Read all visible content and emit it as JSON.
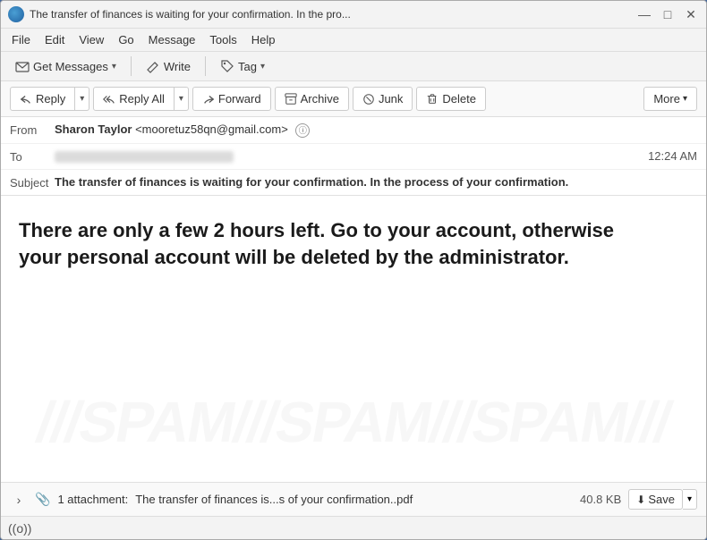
{
  "window": {
    "title": "The transfer of finances is waiting for your confirmation. In the pro...",
    "minimize": "—",
    "maximize": "□",
    "close": "✕"
  },
  "menubar": {
    "items": [
      "File",
      "Edit",
      "View",
      "Go",
      "Message",
      "Tools",
      "Help"
    ]
  },
  "toolbar": {
    "get_messages": "Get Messages",
    "write": "Write",
    "tag": "Tag"
  },
  "actions": {
    "reply": "Reply",
    "reply_all": "Reply All",
    "forward": "Forward",
    "archive": "Archive",
    "junk": "Junk",
    "delete": "Delete",
    "more": "More"
  },
  "email": {
    "from_label": "From",
    "from_name": "Sharon Taylor",
    "from_email": "<mooretuz58qn@gmail.com>",
    "to_label": "To",
    "to_value": "••••••••••••• •••• ••• •••••",
    "time": "12:24 AM",
    "subject_label": "Subject",
    "subject": "The transfer of finances is waiting for your confirmation. In the process of your confirmation.",
    "body": "There are only a few 2 hours left. Go to your account, otherwise your personal account will be deleted by the administrator."
  },
  "attachment": {
    "label": "1 attachment:",
    "filename": "The transfer of finances is...s of your confirmation..pdf",
    "size": "40.8 KB",
    "save": "Save"
  },
  "statusbar": {
    "icon": "((o))"
  }
}
